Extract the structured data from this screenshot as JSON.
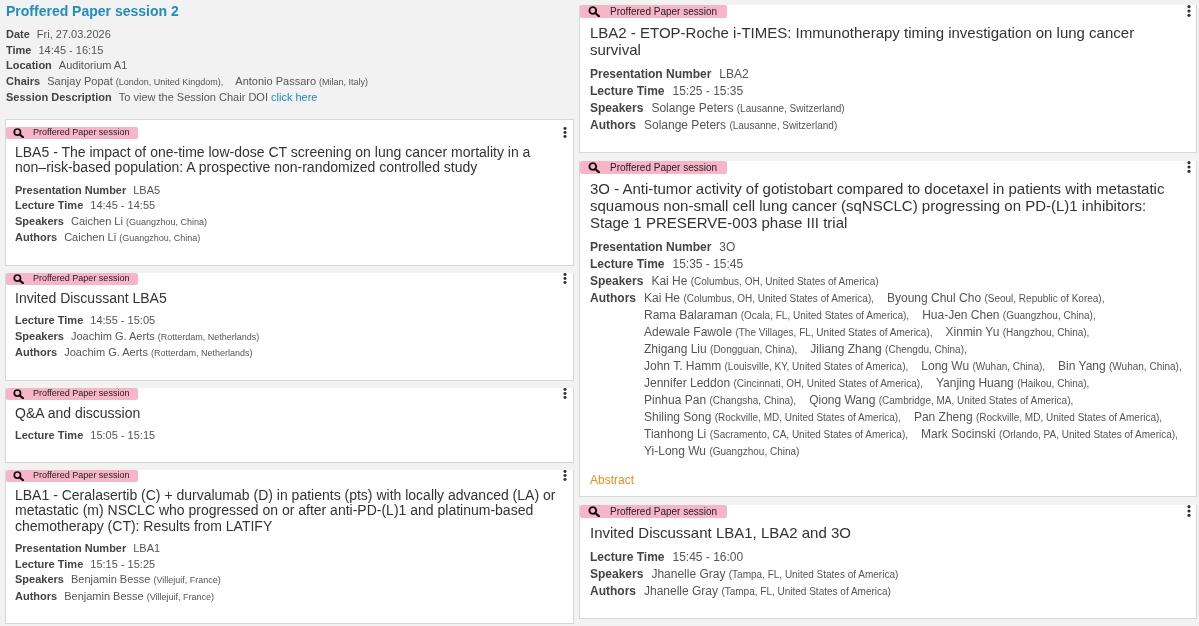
{
  "columns": [
    {
      "session": {
        "title": "Proffered Paper session 2",
        "details": [
          {
            "kind": "text",
            "label": "Date",
            "value": "Fri, 27.03.2026"
          },
          {
            "kind": "text",
            "label": "Time",
            "value": "14:45 - 16:15"
          },
          {
            "kind": "text",
            "label": "Location",
            "value": "Auditorium A1"
          },
          {
            "kind": "people",
            "label": "Chairs",
            "people": [
              {
                "name": "Sanjay Popat",
                "place": "(London, United Kingdom),"
              },
              {
                "name": "Antonio Passaro",
                "place": "(Milan, Italy)"
              }
            ]
          },
          {
            "kind": "link_text",
            "label": "Session Description",
            "text": "To view the Session Chair DOI",
            "link": "click here"
          }
        ]
      },
      "cards": [
        {
          "tag": "Proffered Paper session",
          "title": "LBA5 - The impact of one-time low-dose CT screening on lung cancer mortality in a non–risk-based population: A prospective non-randomized controlled study",
          "fields": [
            {
              "kind": "text",
              "label": "Presentation Number",
              "value": "LBA5"
            },
            {
              "kind": "text",
              "label": "Lecture Time",
              "value": "14:45 - 14:55"
            },
            {
              "kind": "people",
              "label": "Speakers",
              "people": [
                {
                  "name": "Caichen Li",
                  "place": "(Guangzhou, China)"
                }
              ]
            },
            {
              "kind": "people",
              "label": "Authors",
              "people": [
                {
                  "name": "Caichen Li",
                  "place": "(Guangzhou, China)"
                }
              ]
            }
          ]
        },
        {
          "tag": "Proffered Paper session",
          "title": "Invited Discussant LBA5",
          "fields": [
            {
              "kind": "text",
              "label": "Lecture Time",
              "value": "14:55 - 15:05"
            },
            {
              "kind": "people",
              "label": "Speakers",
              "people": [
                {
                  "name": "Joachim G. Aerts",
                  "place": "(Rotterdam, Netherlands)"
                }
              ]
            },
            {
              "kind": "people",
              "label": "Authors",
              "people": [
                {
                  "name": "Joachim G. Aerts",
                  "place": "(Rotterdam, Netherlands)"
                }
              ]
            }
          ]
        },
        {
          "tag": "Proffered Paper session",
          "title": "Q&A and discussion",
          "fields": [
            {
              "kind": "text",
              "label": "Lecture Time",
              "value": "15:05 - 15:15"
            }
          ]
        },
        {
          "tag": "Proffered Paper session",
          "title": "LBA1 - Ceralasertib (C) + durvalumab (D) in patients (pts) with locally advanced (LA) or metastatic (m) NSCLC who progressed on or after anti-PD-(L)1 and platinum-based chemotherapy (CT): Results from LATIFY",
          "fields": [
            {
              "kind": "text",
              "label": "Presentation Number",
              "value": "LBA1"
            },
            {
              "kind": "text",
              "label": "Lecture Time",
              "value": "15:15 - 15:25"
            },
            {
              "kind": "people",
              "label": "Speakers",
              "people": [
                {
                  "name": "Benjamin Besse",
                  "place": "(Villejuif, France)"
                }
              ]
            },
            {
              "kind": "people",
              "label": "Authors",
              "people": [
                {
                  "name": "Benjamin Besse",
                  "place": "(Villejuif, France)"
                }
              ]
            }
          ]
        }
      ]
    },
    {
      "cards": [
        {
          "tag": "Proffered Paper session",
          "title": "LBA2 - ETOP-Roche i-TIMES: Immunotherapy timing investigation on lung cancer survival",
          "fields": [
            {
              "kind": "text",
              "label": "Presentation Number",
              "value": "LBA2"
            },
            {
              "kind": "text",
              "label": "Lecture Time",
              "value": "15:25 - 15:35"
            },
            {
              "kind": "people",
              "label": "Speakers",
              "people": [
                {
                  "name": "Solange Peters",
                  "place": "(Lausanne, Switzerland)"
                }
              ]
            },
            {
              "kind": "people",
              "label": "Authors",
              "people": [
                {
                  "name": "Solange Peters",
                  "place": "(Lausanne, Switzerland)"
                }
              ]
            }
          ]
        },
        {
          "tag": "Proffered Paper session",
          "title": "3O - Anti-tumor activity of gotistobart compared to docetaxel in patients with metastatic squamous non-small cell lung cancer (sqNSCLC) progressing on PD-(L)1 inhibitors: Stage 1 PRESERVE-003 phase III trial",
          "fields": [
            {
              "kind": "text",
              "label": "Presentation Number",
              "value": "3O"
            },
            {
              "kind": "text",
              "label": "Lecture Time",
              "value": "15:35 - 15:45"
            },
            {
              "kind": "people",
              "label": "Speakers",
              "people": [
                {
                  "name": "Kai He",
                  "place": "(Columbus, OH, United States of America)"
                }
              ]
            },
            {
              "kind": "people",
              "label": "Authors",
              "people": [
                {
                  "name": "Kai He",
                  "place": "(Columbus, OH, United States of America),"
                },
                {
                  "name": "Byoung Chul Cho",
                  "place": "(Seoul, Republic of Korea),"
                },
                {
                  "name": "Rama Balaraman",
                  "place": "(Ocala, FL, United States of America),"
                },
                {
                  "name": "Hua-Jen Chen",
                  "place": "(Guangzhou, China),"
                },
                {
                  "name": "Adewale Fawole",
                  "place": "(The Villages, FL, United States of America),"
                },
                {
                  "name": "Xinmin Yu",
                  "place": "(Hangzhou, China),"
                },
                {
                  "name": "Zhigang Liu",
                  "place": "(Dongguan, China),"
                },
                {
                  "name": "Jiliang Zhang",
                  "place": "(Chengdu, China),"
                },
                {
                  "name": "John T. Hamm",
                  "place": "(Louisville, KY, United States of America),"
                },
                {
                  "name": "Long Wu",
                  "place": "(Wuhan, China),"
                },
                {
                  "name": "Bin Yang",
                  "place": "(Wuhan, China),"
                },
                {
                  "name": "Jennifer Leddon",
                  "place": "(Cincinnati, OH, United States of America),"
                },
                {
                  "name": "Yanjing Huang",
                  "place": "(Haikou, China),"
                },
                {
                  "name": "Pinhua Pan",
                  "place": "(Changsha, China),"
                },
                {
                  "name": "Qiong Wang",
                  "place": "(Cambridge, MA, United States of America),"
                },
                {
                  "name": "Shiling Song",
                  "place": "(Rockville, MD, United States of America),"
                },
                {
                  "name": "Pan Zheng",
                  "place": "(Rockville, MD, United States of America),"
                },
                {
                  "name": "Tianhong Li",
                  "place": "(Sacramento, CA, United States of America),"
                },
                {
                  "name": "Mark Socinski",
                  "place": "(Orlando, PA, United States of America),"
                },
                {
                  "name": "Yi-Long Wu",
                  "place": "(Guangzhou, China)"
                }
              ]
            }
          ],
          "link": "Abstract"
        },
        {
          "tag": "Proffered Paper session",
          "title": "Invited Discussant LBA1, LBA2 and 3O",
          "fields": [
            {
              "kind": "text",
              "label": "Lecture Time",
              "value": "15:45 - 16:00"
            },
            {
              "kind": "people",
              "label": "Speakers",
              "people": [
                {
                  "name": "Jhanelle Gray",
                  "place": "(Tampa, FL, United States of America)"
                }
              ]
            },
            {
              "kind": "people",
              "label": "Authors",
              "people": [
                {
                  "name": "Jhanelle Gray",
                  "place": "(Tampa, FL, United States of America)"
                }
              ]
            }
          ]
        }
      ]
    }
  ]
}
